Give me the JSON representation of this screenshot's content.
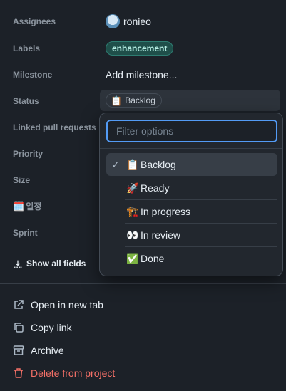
{
  "fields": {
    "assignees": {
      "label": "Assignees",
      "value": "ronieo"
    },
    "labels": {
      "label": "Labels",
      "value": "enhancement"
    },
    "milestone": {
      "label": "Milestone",
      "placeholder": "Add milestone..."
    },
    "status": {
      "label": "Status",
      "value": "Backlog",
      "emoji": "📋"
    },
    "linked_prs": {
      "label": "Linked pull requests"
    },
    "priority": {
      "label": "Priority"
    },
    "size": {
      "label": "Size"
    },
    "schedule": {
      "label": "일정",
      "emoji": "🗓️"
    },
    "sprint": {
      "label": "Sprint"
    }
  },
  "show_all_fields": "Show all fields",
  "actions": {
    "open_new_tab": "Open in new tab",
    "copy_link": "Copy link",
    "archive": "Archive",
    "delete": "Delete from project"
  },
  "dropdown": {
    "filter_placeholder": "Filter options",
    "options": [
      {
        "label": "Backlog",
        "emoji": "📋",
        "selected": true
      },
      {
        "label": "Ready",
        "emoji": "🚀",
        "selected": false
      },
      {
        "label": "In progress",
        "emoji": "🏗️",
        "selected": false
      },
      {
        "label": "In review",
        "emoji": "👀",
        "selected": false
      },
      {
        "label": "Done",
        "emoji": "✅",
        "selected": false
      }
    ]
  },
  "colors": {
    "background": "#1c2128",
    "accent": "#539bf5",
    "danger": "#f47067",
    "label_pill_bg": "#1f4f4a"
  }
}
